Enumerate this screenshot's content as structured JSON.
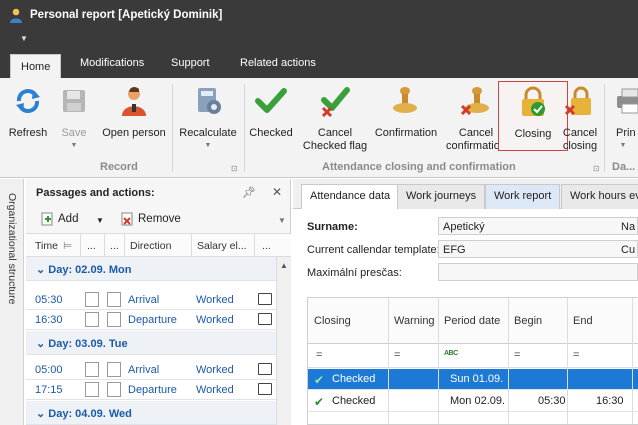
{
  "window": {
    "title": "Personal report [Apetický Dominik]"
  },
  "tabs": [
    "Home",
    "Modifications",
    "Support",
    "Related actions"
  ],
  "ribbon": {
    "record_group": "Record",
    "attendance_group": "Attendance closing and confirmation",
    "da_group": "Da...",
    "buttons": {
      "refresh": "Refresh",
      "save": "Save",
      "open_person": "Open person",
      "recalculate": "Recalculate",
      "checked": "Checked",
      "cancel_checked_1": "Cancel",
      "cancel_checked_2": "Checked flag",
      "confirmation": "Confirmation",
      "cancel_conf_1": "Cancel",
      "cancel_conf_2": "confirmation",
      "closing": "Closing",
      "cancel_closing_1": "Cancel",
      "cancel_closing_2": "closing",
      "print": "Prin"
    }
  },
  "sidebar": {
    "vertical_label": "Organizational structure"
  },
  "passages": {
    "title": "Passages and actions:",
    "add": "Add",
    "remove": "Remove",
    "columns": [
      "Time",
      "...",
      "...",
      "Direction",
      "Salary el...",
      "..."
    ],
    "days": [
      {
        "label": "Day: 02.09. Mon",
        "rows": [
          {
            "time": "05:30",
            "direction": "Arrival",
            "salary": "Worked"
          },
          {
            "time": "16:30",
            "direction": "Departure",
            "salary": "Worked"
          }
        ]
      },
      {
        "label": "Day: 03.09. Tue",
        "rows": [
          {
            "time": "05:00",
            "direction": "Arrival",
            "salary": "Worked"
          },
          {
            "time": "17:15",
            "direction": "Departure",
            "salary": "Worked"
          }
        ]
      },
      {
        "label": "Day: 04.09. Wed",
        "rows": []
      }
    ]
  },
  "right_tabs": [
    "Attendance data",
    "Work journeys",
    "Work report",
    "Work hours ev"
  ],
  "form": {
    "surname_label": "Surname:",
    "surname_value": "Apetický",
    "template_label": "Current callendar template:",
    "template_value": "EFG",
    "overtime_label": "Maximální presčas:",
    "overtime_value": "",
    "side_na": "Na",
    "side_cu": "Cu"
  },
  "attendance": {
    "columns": [
      "Closing",
      "Warning",
      "Period date",
      "Begin",
      "End"
    ],
    "filter_eq": "=",
    "filter_abc": "ABC",
    "rows": [
      {
        "closing": "Checked",
        "period": "Sun 01.09.",
        "begin": "",
        "end": "",
        "selected": true
      },
      {
        "closing": "Checked",
        "period": "Mon 02.09.",
        "begin": "05:30",
        "end": "16:30",
        "selected": false
      }
    ]
  },
  "colors": {
    "accent": "#1c7ad6",
    "link": "#1b5aa8",
    "titlebar": "#3a3a3a",
    "check": "#2e8b2e"
  }
}
